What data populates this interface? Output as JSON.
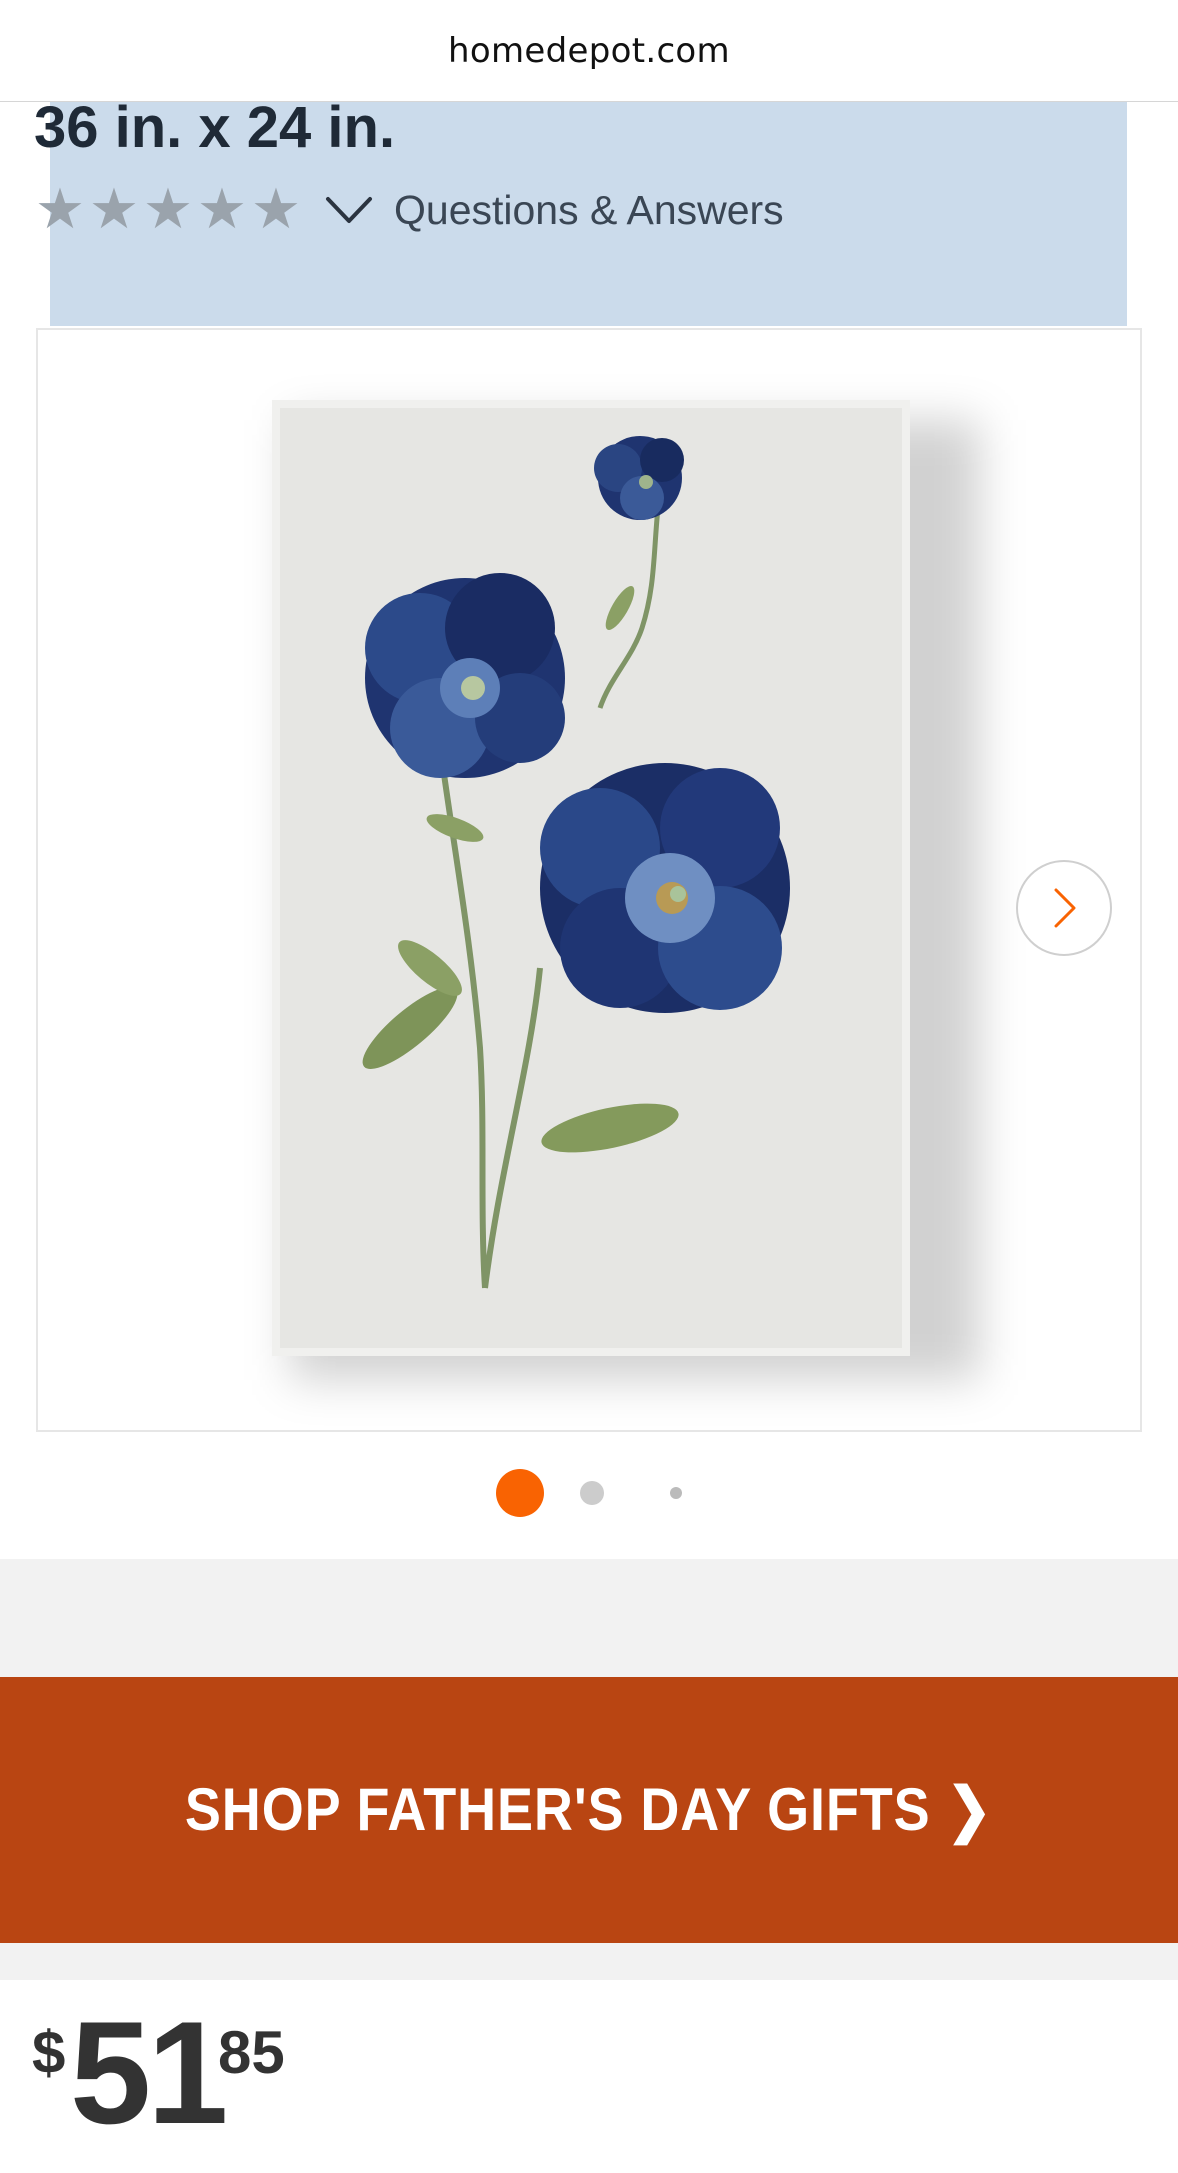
{
  "browser": {
    "url": "homedepot.com"
  },
  "product": {
    "title_fragment": "36 in. x 24 in.",
    "rating_stars": 0,
    "qa_link": "Questions & Answers",
    "image_alt": "Blue flower painting on canvas",
    "gallery_index": 1,
    "gallery_count": 3
  },
  "promo": {
    "label": "SHOP FATHER'S DAY GIFTS ❯",
    "color": "#b94512"
  },
  "price": {
    "currency": "$",
    "dollars": "51",
    "cents": "85"
  },
  "colors": {
    "accent": "#f96302",
    "highlight": "#cbdbeb"
  },
  "icons": {
    "stars": "star-icon",
    "expand": "chevron-down-icon",
    "next": "chevron-right-icon"
  }
}
